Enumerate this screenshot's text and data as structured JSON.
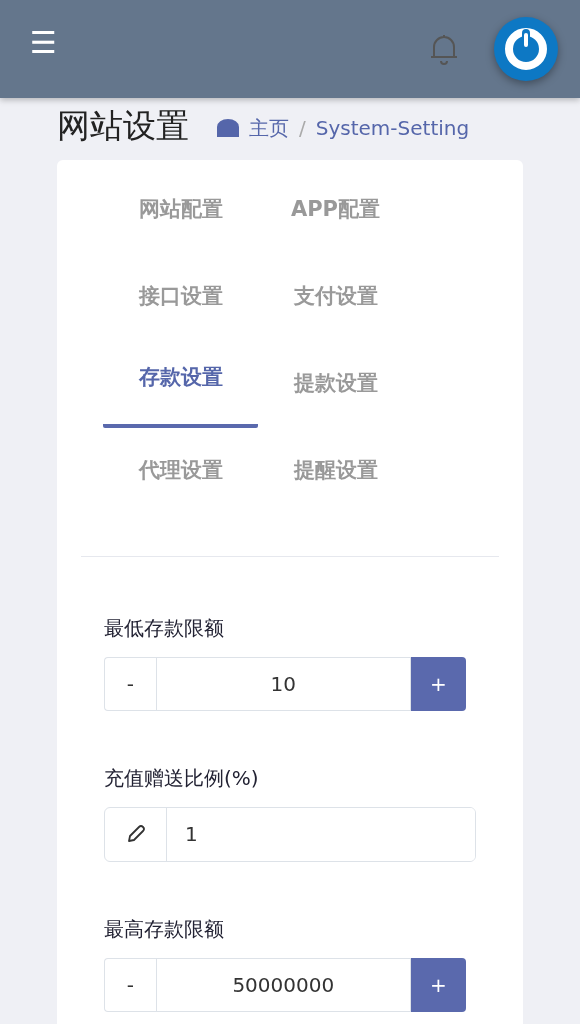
{
  "header": {
    "menu_icon": "☰"
  },
  "page": {
    "title": "网站设置",
    "separator": "/",
    "breadcrumb": [
      {
        "label": "主页"
      },
      {
        "label": "System-Setting"
      }
    ]
  },
  "tabs": [
    {
      "label": "网站配置",
      "selected": false
    },
    {
      "label": "APP配置",
      "selected": false
    },
    {
      "label": "接口设置",
      "selected": false
    },
    {
      "label": "支付设置",
      "selected": false
    },
    {
      "label": "存款设置",
      "selected": true
    },
    {
      "label": "提款设置",
      "selected": false
    },
    {
      "label": "代理设置",
      "selected": false
    },
    {
      "label": "提醒设置",
      "selected": false
    }
  ],
  "fields": [
    {
      "kind": "stepper",
      "label": "最低存款限额",
      "value": "10",
      "minus": "-",
      "plus": "+"
    },
    {
      "kind": "icon-input",
      "label": "充值赠送比例(%)",
      "value": "1"
    },
    {
      "kind": "stepper",
      "label": "最高存款限额",
      "value": "50000000",
      "minus": "-",
      "plus": "+"
    }
  ]
}
